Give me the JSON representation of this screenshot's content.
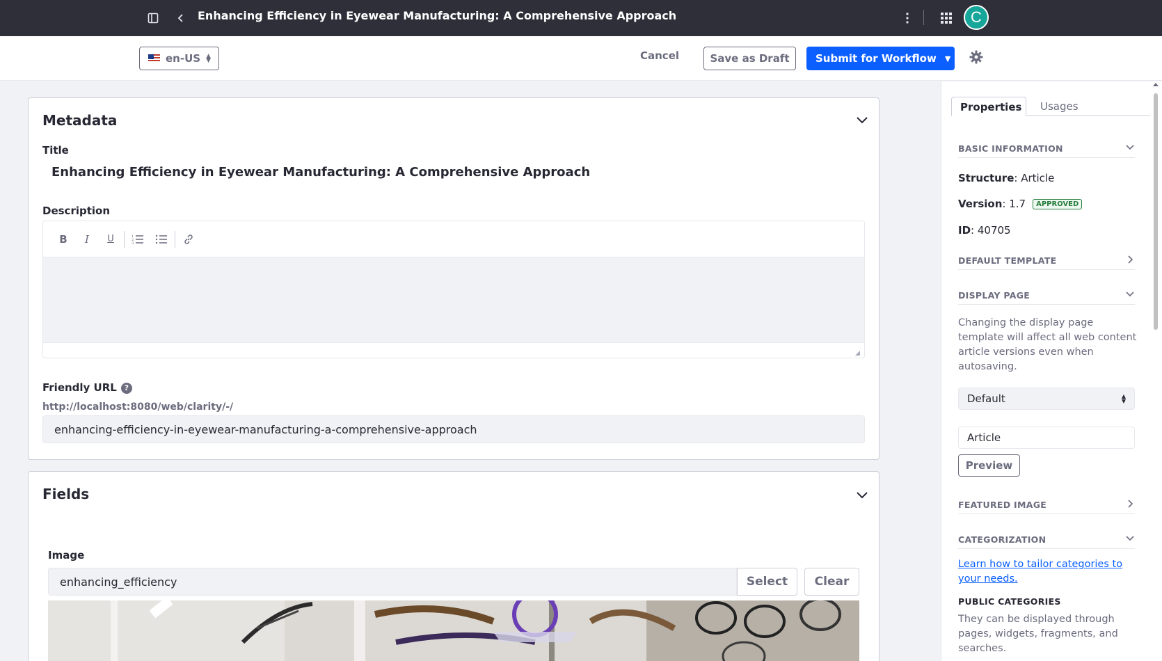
{
  "topbar": {
    "title": "Enhancing Efficiency in Eyewear Manufacturing: A Comprehensive Approach",
    "avatar_letter": "C",
    "icons": [
      "sidebar-toggle-icon",
      "back-icon",
      "kebab-icon",
      "apps-grid-icon"
    ]
  },
  "toolbar": {
    "locale": "en-US",
    "cancel_label": "Cancel",
    "save_draft_label": "Save as Draft",
    "submit_label": "Submit for Workflow",
    "accent_color": "#0b5fff"
  },
  "metadata": {
    "heading": "Metadata",
    "title_label": "Title",
    "title_value": "Enhancing Efficiency in Eyewear Manufacturing: A Comprehensive Approach",
    "description_label": "Description",
    "description_value": "",
    "editor_tools": [
      "bold-icon",
      "italic-icon",
      "underline-icon",
      "numbered-list-icon",
      "bulleted-list-icon",
      "link-icon"
    ],
    "friendly_url_label": "Friendly URL",
    "friendly_url_prefix": "http://localhost:8080/web/clarity/-/",
    "friendly_url_value": "enhancing-efficiency-in-eyewear-manufacturing-a-comprehensive-approach"
  },
  "fields": {
    "heading": "Fields",
    "image_label": "Image",
    "image_value": "enhancing_efficiency",
    "select_label": "Select",
    "clear_label": "Clear"
  },
  "sidebar": {
    "tabs": [
      {
        "label": "Properties",
        "active": true
      },
      {
        "label": "Usages",
        "active": false
      }
    ],
    "basic_info_heading": "BASIC INFORMATION",
    "structure_label": "Structure",
    "structure_value": "Article",
    "version_label": "Version",
    "version_value": "1.7",
    "version_status": "APPROVED",
    "id_label": "ID",
    "id_value": "40705",
    "default_template_heading": "DEFAULT TEMPLATE",
    "display_page_heading": "DISPLAY PAGE",
    "display_page_note": "Changing the display page template will affect all web content article versions even when autosaving.",
    "display_page_select": "Default",
    "display_page_input": "Article",
    "preview_label": "Preview",
    "featured_image_heading": "FEATURED IMAGE",
    "categorization_heading": "CATEGORIZATION",
    "categories_link": "Learn how to tailor categories to your needs.",
    "public_categories_heading": "PUBLIC CATEGORIES",
    "public_categories_note": "They can be displayed through pages, widgets, fragments, and searches."
  }
}
